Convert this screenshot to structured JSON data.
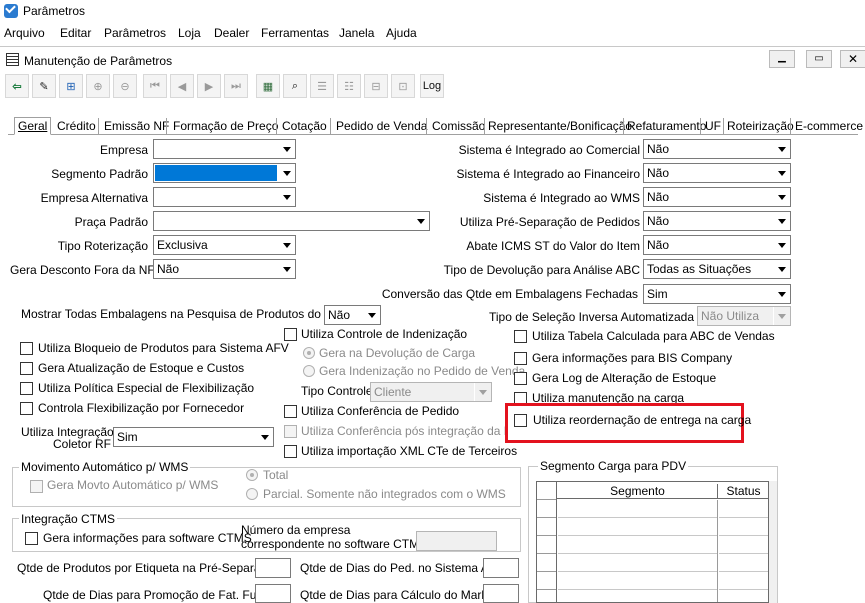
{
  "app": {
    "title": "Parâmetros"
  },
  "menu": [
    "Arquivo",
    "Editar",
    "Parâmetros",
    "Loja",
    "Dealer",
    "Ferramentas",
    "Janela",
    "Ajuda"
  ],
  "window": {
    "title": "Manutenção de Parâmetros"
  },
  "toolbar": {
    "log_label": "Log"
  },
  "tabs": [
    "Geral",
    "Crédito",
    "Emissão NF",
    "Formação de Preço",
    "Cotação",
    "Pedido de Venda",
    "Comissão",
    "Representante/Bonificação",
    "Refaturamento",
    "UF",
    "Roteirização",
    "E-commerce"
  ],
  "left_fields": {
    "empresa": {
      "label": "Empresa",
      "value": ""
    },
    "segmento": {
      "label": "Segmento Padrão",
      "value": ""
    },
    "empresa_alt": {
      "label": "Empresa Alternativa",
      "value": ""
    },
    "praca": {
      "label": "Praça Padrão",
      "value": ""
    },
    "tipo_rot": {
      "label": "Tipo Roterização",
      "value": "Exclusiva"
    },
    "gera_desc": {
      "label": "Gera Desconto Fora da NF",
      "value": "Não"
    }
  },
  "right_fields": {
    "comercial": {
      "label": "Sistema é Integrado ao Comercial",
      "value": "Não"
    },
    "financeiro": {
      "label": "Sistema é Integrado ao Financeiro",
      "value": "Não"
    },
    "wms": {
      "label": "Sistema é Integrado ao WMS",
      "value": "Não"
    },
    "pre_sep": {
      "label": "Utiliza Pré-Separação de Pedidos",
      "value": "Não"
    },
    "abate": {
      "label": "Abate ICMS ST do Valor do Item",
      "value": "Não"
    },
    "devolucao": {
      "label": "Tipo de Devolução para Análise ABC",
      "value": "Todas as Situações"
    },
    "conversao": {
      "label": "Conversão das Qtde em Embalagens Fechadas",
      "value": "Sim"
    },
    "selecao_inv": {
      "label": "Tipo de Seleção Inversa Automatizada",
      "value": "Não Utiliza"
    }
  },
  "mostrar_emb": {
    "label": "Mostrar Todas Embalagens na Pesquisa de Produtos do Venda",
    "value": "Não"
  },
  "checks_left": [
    "Utiliza Bloqueio de Produtos para Sistema AFV",
    "Gera Atualização de Estoque e Custos",
    "Utiliza Política Especial de Flexibilização",
    "Controla Flexibilização por Fornecedor"
  ],
  "integracao_coletor": {
    "label1": "Utiliza Integração",
    "label2": "Coletor RF",
    "value": "Sim"
  },
  "indenizacao": {
    "check": "Utiliza Controle de Indenização",
    "radio1": "Gera na Devolução de Carga",
    "radio2": "Gera Indenização no Pedido de Venda",
    "tipo_label": "Tipo Controle",
    "tipo_value": "Cliente"
  },
  "checks_mid": [
    "Utiliza Conferência de Pedido",
    "Utiliza Conferência pós integração da NF",
    "Utiliza importação XML CTe de Terceiros"
  ],
  "checks_right": [
    "Utiliza Tabela Calculada para ABC de Vendas",
    "Gera informações para BIS Company",
    "Gera Log de Alteração de Estoque",
    "Utiliza manutenção na carga"
  ],
  "highlight_check": "Utiliza reordernação de entrega na carga",
  "wms_group": {
    "title": "Movimento Automático p/ WMS",
    "check": "Gera Movto Automático p/ WMS",
    "radio1": "Total",
    "radio2": "Parcial. Somente não integrados com o WMS"
  },
  "ctms_group": {
    "title": "Integração CTMS",
    "check": "Gera informações para software CTMS",
    "num_label1": "Número da empresa",
    "num_label2": "correspondente no software CTMS"
  },
  "pdv_group": {
    "title": "Segmento Carga para PDV",
    "col1": "Segmento",
    "col2": "Status"
  },
  "bottom": {
    "etiqueta": "Qtde de Produtos por Etiqueta na Pré-Separação",
    "dias_afv": "Qtde de Dias do Ped. no Sistema AFV",
    "dias_promo": "Qtde de Dias para Promoção de Fat. Futuro",
    "dias_markup": "Qtde de Dias para Cálculo do Markup"
  },
  "colors": {
    "highlight": "#e3121e",
    "selection": "#0078d7",
    "title_bar": "#ffffff"
  }
}
